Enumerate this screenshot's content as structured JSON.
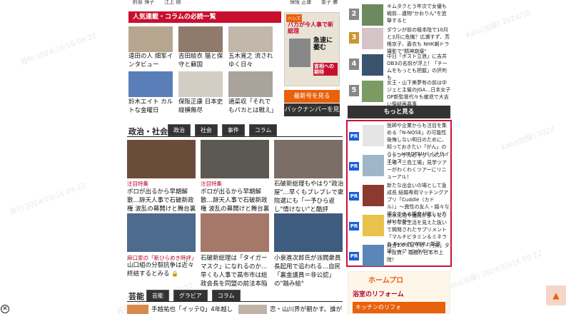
{
  "top_names": [
    "鈴原 博子",
    "江上 剛",
    "保阪 正康",
    "金子 勝"
  ],
  "columns": {
    "header": "人気連載・コラムの必読一覧",
    "items": [
      {
        "label": "遠田の人 畑军インタビュー"
      },
      {
        "label": "吉田絵衣 猫と保守と蘇国"
      },
      {
        "label": "五木寛之 流されゆく日々"
      },
      {
        "label": "鈴木エイト カルトな金曜日"
      },
      {
        "label": "保阪正康 日本史縦横無尽"
      },
      {
        "label": "適菜収「それでもバカとは戦え」"
      }
    ]
  },
  "magazine": {
    "cover_tag": "ハンズ",
    "cover_headline": "バカが今人事で新総理",
    "cover_sub": "急速に萎む",
    "cover_vertical": "首相への期待",
    "latest_button": "最新号を見る",
    "back_button": "バックナンバーを見る"
  },
  "politics": {
    "header": "政治・社会",
    "tabs": [
      "政治",
      "社会",
      "事件",
      "コラム"
    ],
    "articles": [
      {
        "label": "注目特集",
        "title": "ボロが出るから早期解散…辞天人事で石破新政権 波乱の幕開けと舞台裏【前編】",
        "locked": true
      },
      {
        "label": "注目特集",
        "title": "ボロが出るから早期解散…辞天人事で石破新政権 波乱の幕開けと舞台裏【後編】",
        "locked": true
      },
      {
        "label": "",
        "title": "石破新総理もやはり\"政治屋\"…早くもブレブレで衆院選にも「一予ひら返し\"情けない\"と酷評",
        "locked": false
      },
      {
        "label": "麻口家の「新ひらめき時評」",
        "title": "山口組の分裂抗争は近々終結するとみる",
        "locked": true
      },
      {
        "label": "",
        "title": "石破新総理は「タイガーマスク」になれるのか…早くも人事で高市市は総政会長を同盟の前法本陥",
        "locked": false
      },
      {
        "label": "",
        "title": "小泉進次郎氏が派閥衆員長起用で追われる…自民「裏金議員＝非公認」の\"踏み絵\"",
        "locked": false
      }
    ]
  },
  "entertainment": {
    "header": "芸能",
    "tabs": [
      "芸能",
      "グラビア",
      "コラム"
    ],
    "preview_1": "手越祐也「イッテQ」4年越し出",
    "preview_2": "恋・山川界が朝かす。誰がいは"
  },
  "ranking": {
    "items": [
      {
        "rank": "2",
        "text": "キムタクとう年次で女優も戦前…遺物\"かおりん\"を追撃すると"
      },
      {
        "rank": "3",
        "text": "ダウンが前の極本陰で10月と3月に危機？広瀬すず、芳根京子、蒼衣も NHK朝ドラ撮影で\"精神崩壊\""
      },
      {
        "rank": "4",
        "text": "中日「ポスト立浪」に吉井 OB3の名前が浮上！「チームをもっとも把握」の評判も"
      },
      {
        "rank": "5",
        "text": "女王・山下美夢有の前は中ジェと主催のJGA…日本女子OP新監督代々も撤退で大吉い懐疑再募事"
      }
    ],
    "more_button": "もっと見る"
  },
  "pr": {
    "items": [
      {
        "badge": "PR",
        "text": "医師や企業からも注目を集める「N-NOSE」の可能性 後悔しない明日のために、知っておきたい「がん」のこと〜HIROTSUバイオサイエンス"
      },
      {
        "badge": "PR",
        "text": "ファンケルのサプリメント工場「三島工場」見学ツアーがわくわくツアーにリニューアル！"
      },
      {
        "badge": "PR",
        "text": "新たな出会いの場として急成長 結婚専用マッチングアプリ「Cuddle（カドル）」〜異性の友人・婚々な場合できる婚恋が欲しい方はいかが〜"
      },
      {
        "badge": "PR",
        "text": "炭水化物や脂質が多くなりがちな食生活を見えた抜いて開発されたサプリメント「マルチビタミン＆ミネラル Base POWER」新登場！〜ファンケル〜"
      },
      {
        "badge": "PR",
        "text": "競合1.0%以下の「円安」タイ投資！ 議題が日本市上陸！"
      }
    ]
  },
  "ads": {
    "homepro_logo": "ホームプロ",
    "reform_1": "浴室のリフォーム",
    "reform_2": "キッチンのリフォ"
  },
  "watermarks": [
    "週刊 2024/10/16 09:22",
    "週刊 2024/10/16 09:22",
    "Kato(加藤) 2024",
    "週刊 2024/10/16 09:22",
    "Kato(加藤) 2024/10/16 09:22",
    "Kato(加藤) 2024/10"
  ],
  "colors": {
    "accent": "#c8102e",
    "pr_blue": "#1c5fd6",
    "orange": "#e8610c",
    "dark": "#333333"
  },
  "icons": [
    "close-icon",
    "arrow-up-icon",
    "lock-icon"
  ]
}
